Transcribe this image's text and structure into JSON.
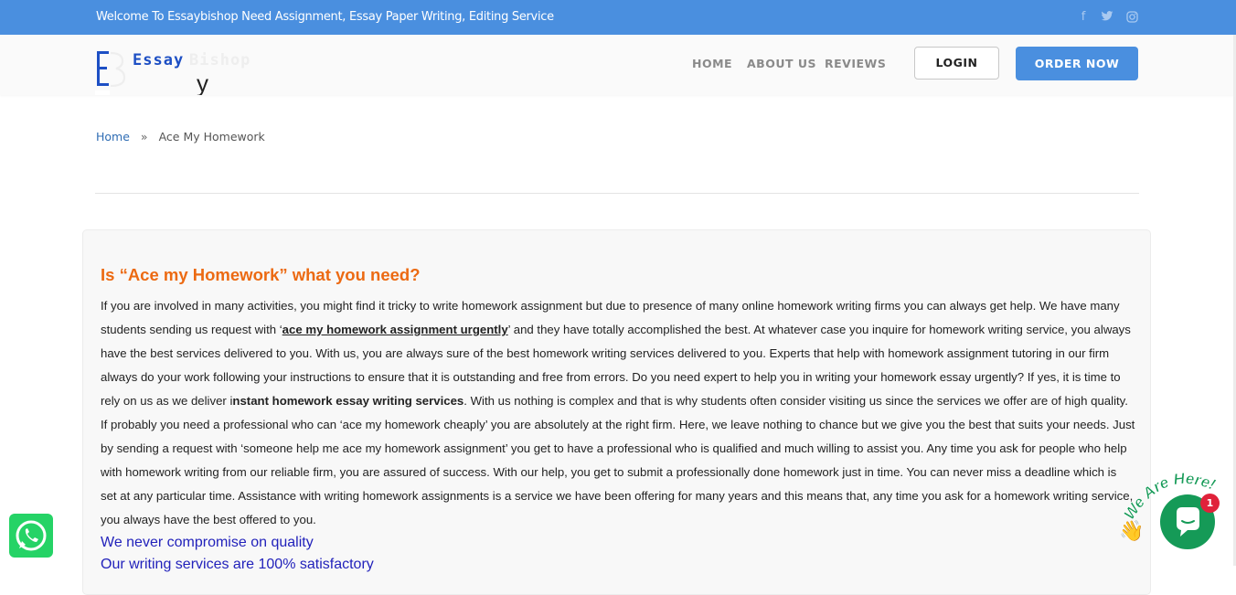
{
  "topbar": {
    "welcome": "Welcome To Essaybishop Need Assignment, Essay Paper Writing, Editing Service",
    "social_icons": [
      "facebook-icon",
      "twitter-icon",
      "instagram-icon"
    ]
  },
  "brand": {
    "word1": "Essay",
    "word2": "Bishop"
  },
  "nav": {
    "home": "HOME",
    "about": "ABOUT US",
    "reviews": "REVIEWS",
    "login": "LOGIN",
    "order": "ORDER NOW"
  },
  "breadcrumb": {
    "home": "Home",
    "sep": "»",
    "current": "Ace My Homework"
  },
  "article": {
    "heading": "Is “Ace my Homework” what you need?",
    "p1": "If you are involved in many activities, you might find it tricky to write homework assignment but due to presence of many online homework writing firms you can always get help. We have many students sending us request with ‘",
    "link1": "ace my homework assignment urgently",
    "p2": "’ and they have totally accomplished the best. At whatever case you inquire for homework writing service, you always have the best services delivered to you. With us, you are always sure of the best homework writing services delivered to you. Experts that help with homework assignment tutoring in our firm always do your work following your instructions to ensure that it is outstanding and free from errors. Do you need expert to help you in writing your homework essay urgently? If yes, it is time to rely on us as we deliver i",
    "bold1": "nstant homework essay writing services",
    "p3": ". With us nothing is complex and that is why students often consider visiting us since the services we offer are of high quality. If probably you need a professional who can ‘ace my homework cheaply’ you are absolutely at the right firm. Here, we leave nothing to chance but we give you the best that suits your needs. Just by sending a request with ‘someone help me ace my homework assignment’ you get to have a professional who is qualified and much willing to assist you. Any time you ask for people who help with homework writing from our reliable firm, you are assured of success. With our help, you get to submit a professionally done homework just in time. You can never miss a deadline which is set at any particular time. Assistance with writing homework assignments is a service we have been offering for many years and this means that, any time you ask for a homework writing service, you always have the best offered to you.",
    "sub1": "We never compromise on quality",
    "sub2": "Our writing services are 100% satisfactory"
  },
  "widgets": {
    "chat_badge": "1",
    "chat_banner": "We Are Here!"
  },
  "colors": {
    "topbar": "#4a8fdf",
    "accent_orange": "#ec6a12",
    "link_blue": "#2f6db4",
    "whatsapp": "#25d366",
    "chat_green": "#159a57"
  }
}
